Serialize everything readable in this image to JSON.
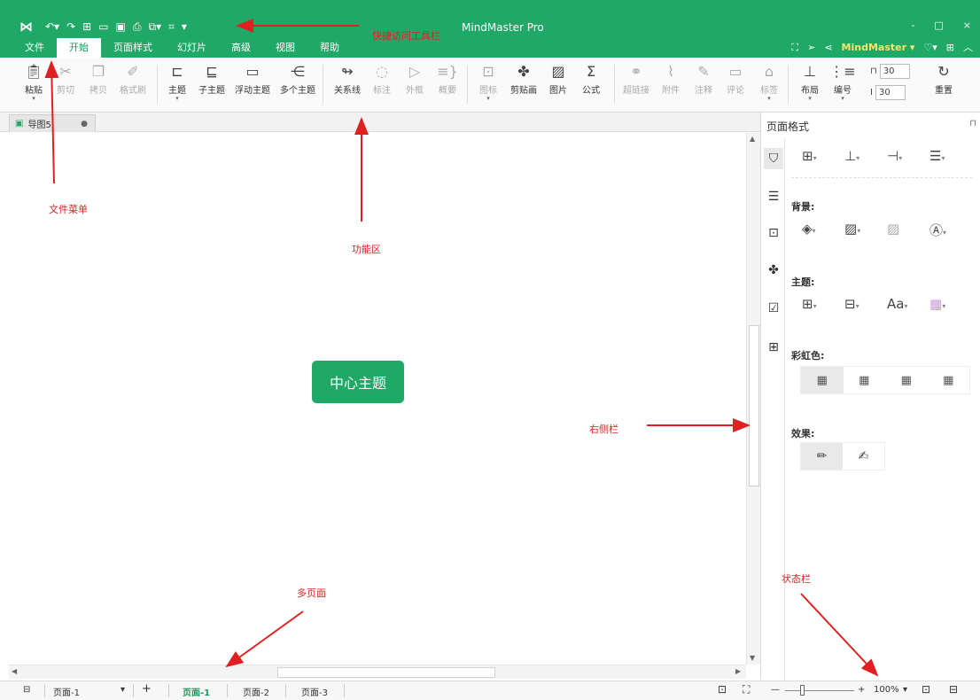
{
  "titlebar": {
    "app_title": "MindMaster Pro",
    "quick_access": [
      "undo-icon",
      "redo-icon",
      "new-icon",
      "open-icon",
      "save-icon",
      "print-icon",
      "export-icon",
      "share-icon",
      "more-icon"
    ],
    "window_controls": {
      "minimize": "-",
      "maximize": "□",
      "close": "×"
    }
  },
  "menu": {
    "tabs": [
      "文件",
      "开始",
      "页面样式",
      "幻灯片",
      "高级",
      "视图",
      "帮助"
    ],
    "active": "开始",
    "brand": "MindMaster ▾"
  },
  "ribbon": {
    "buttons": [
      "粘贴",
      "剪切",
      "拷贝",
      "格式刷",
      "主题",
      "子主题",
      "浮动主题",
      "多个主题",
      "关系线",
      "标注",
      "外框",
      "概要",
      "图标",
      "剪贴画",
      "图片",
      "公式",
      "超链接",
      "附件",
      "注释",
      "评论",
      "标签",
      "布局",
      "编号",
      "重置"
    ],
    "spin_width": "30",
    "spin_height": "30"
  },
  "document": {
    "tab_name": "导图5",
    "central_topic": "中心主题"
  },
  "sidebar": {
    "title": "页面格式",
    "background_label": "背景:",
    "theme_label": "主题:",
    "rainbow_label": "彩虹色:",
    "effect_label": "效果:"
  },
  "statusbar": {
    "page_select": "页面-1",
    "pages": [
      "页面-1",
      "页面-2",
      "页面-3"
    ],
    "active_page": "页面-1",
    "zoom": "100%"
  },
  "annotations": {
    "file_menu": "文件菜单",
    "quick_access": "快捷访问工具栏",
    "ribbon": "功能区",
    "sidebar": "右侧栏",
    "multipage": "多页面",
    "statusbar": "状态栏"
  },
  "colors": {
    "brand": "#1fa866",
    "annotation": "#e02020",
    "highlight": "#ffe36a"
  }
}
